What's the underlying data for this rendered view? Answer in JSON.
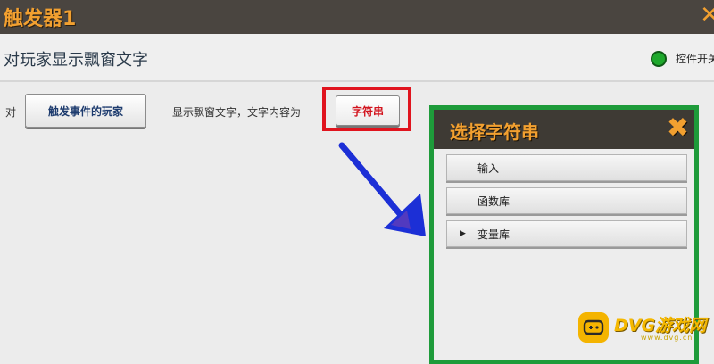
{
  "window": {
    "title": "触发器1",
    "close_glyph": "✕"
  },
  "subheader": {
    "heading": "对玩家显示飘窗文字",
    "toggle_label": "控件开关",
    "toggle_color": "#1ea82c"
  },
  "action": {
    "prefix": "对",
    "target_button": "触发事件的玩家",
    "middle_text": "显示飘窗文字，文字内容为",
    "string_button": "字符串"
  },
  "dialog": {
    "title": "选择字符串",
    "close_glyph": "✖",
    "options": [
      {
        "label": "输入"
      },
      {
        "label": "函数库"
      },
      {
        "label": "变量库",
        "expandable": true
      }
    ]
  },
  "watermark": {
    "text": "DVG游戏网",
    "sub": "www.dvg.cn"
  },
  "colors": {
    "accent": "#f2a030",
    "highlight": "#e0141e",
    "dialog_border": "#1e9b3a",
    "arrow": "#1c2fd6"
  }
}
